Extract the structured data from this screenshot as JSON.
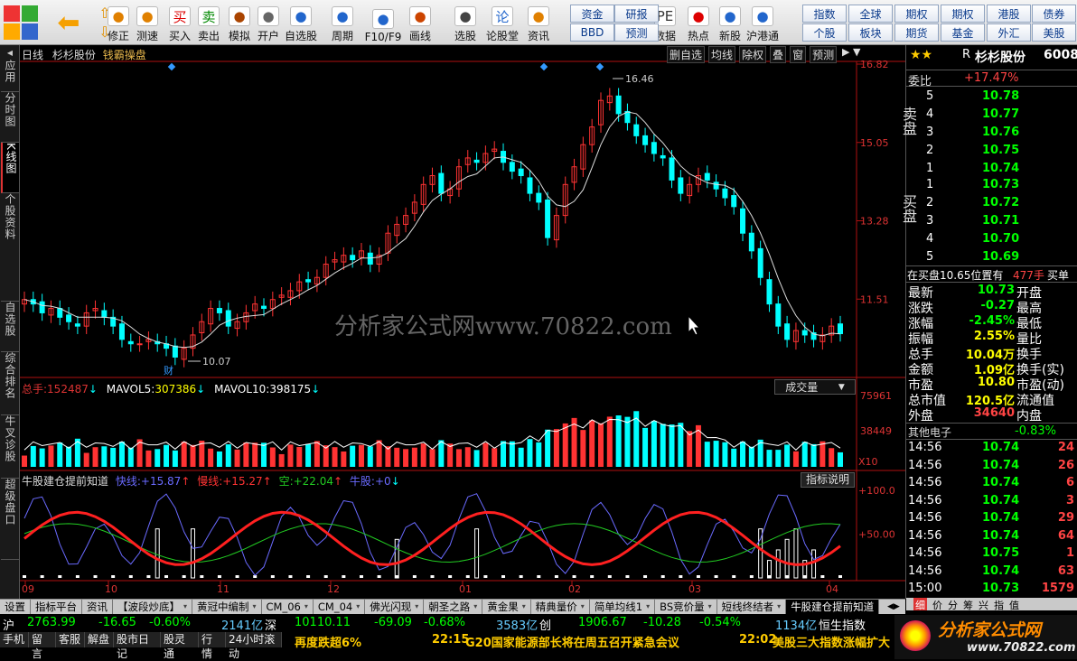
{
  "toolbar": {
    "buttons": [
      {
        "label": "修正",
        "icon": "arrow-up-down-icon"
      },
      {
        "label": "测速",
        "icon": "clock-icon"
      },
      {
        "label": "买入",
        "icon": "buy-icon",
        "glyph": "买"
      },
      {
        "label": "卖出",
        "icon": "sell-icon",
        "glyph": "卖"
      },
      {
        "label": "模拟",
        "icon": "hammer-icon"
      },
      {
        "label": "开户",
        "icon": "lock-icon"
      },
      {
        "label": "自选股",
        "icon": "star-icon"
      },
      {
        "label": "周期",
        "icon": "cycle-icon"
      },
      {
        "label": "F10/F9",
        "icon": "f10-icon"
      },
      {
        "label": "画线",
        "icon": "pencil-icon"
      },
      {
        "label": "选股",
        "icon": "filter-icon"
      },
      {
        "label": "论股堂",
        "icon": "forum-icon",
        "glyph": "论"
      },
      {
        "label": "资讯",
        "icon": "news-icon"
      },
      {
        "label": "数据",
        "icon": "pe-icon",
        "glyph": "PE"
      },
      {
        "label": "热点",
        "icon": "hot-icon"
      },
      {
        "label": "新股",
        "icon": "new-stock-icon"
      },
      {
        "label": "沪港通",
        "icon": "hk-connect-icon"
      }
    ],
    "blue_row1": [
      "资金",
      "研报"
    ],
    "blue_row2": [
      "BBD",
      "预测"
    ],
    "right_row1": [
      "指数",
      "全球",
      "期权",
      "期权",
      "港股",
      "债券"
    ],
    "right_row2": [
      "个股",
      "板块",
      "期货",
      "基金",
      "外汇",
      "美股"
    ]
  },
  "sidetabs": [
    "应用",
    "分时图",
    "K线图",
    "个股资料",
    "自选股",
    "综合排名",
    "牛叉诊股",
    "超级盘口"
  ],
  "chart": {
    "period": "日线",
    "stock": "杉杉股份",
    "indicator_name": "钱霸操盘",
    "buttons": [
      "删自选",
      "均线",
      "除权",
      "叠",
      "窗",
      "预测"
    ],
    "price_axis": [
      "16.82",
      "15.05",
      "13.28",
      "11.51"
    ],
    "high_label": "16.46",
    "low_label": "10.07",
    "cai_label": "财",
    "watermark": "分析家公式网www.70822.com",
    "volume": {
      "total_label": "总手:",
      "total": "152487",
      "ma5_label": "MAVOL5:",
      "ma5": "307386",
      "ma10_label": "MAVOL10:",
      "ma10": "398175",
      "dropdown": "成交量",
      "axis": [
        "75961",
        "38449"
      ],
      "unit": "X10"
    },
    "indicator": {
      "name": "牛股建仓提前知道",
      "fast_label": "快线:",
      "fast": "+15.87",
      "slow_label": "慢线:",
      "slow": "+15.27",
      "kong_label": "空:",
      "kong": "+22.04",
      "niu_label": "牛股:",
      "niu": "+0",
      "help": "指标说明",
      "axis": [
        "+100.0",
        "+50.00"
      ]
    },
    "x_labels": [
      "09",
      "10",
      "11",
      "12",
      "01",
      "02",
      "03",
      "04"
    ]
  },
  "quote": {
    "title": "杉杉股份",
    "code": "6008",
    "wb_label": "委比",
    "wb": "+17.47%",
    "sell_label": "卖盘",
    "buy_label": "买盘",
    "sell": [
      {
        "n": "5",
        "p": "10.78"
      },
      {
        "n": "4",
        "p": "10.77"
      },
      {
        "n": "3",
        "p": "10.76"
      },
      {
        "n": "2",
        "p": "10.75"
      },
      {
        "n": "1",
        "p": "10.74"
      }
    ],
    "buy": [
      {
        "n": "1",
        "p": "10.73"
      },
      {
        "n": "2",
        "p": "10.72"
      },
      {
        "n": "3",
        "p": "10.71"
      },
      {
        "n": "4",
        "p": "10.70"
      },
      {
        "n": "5",
        "p": "10.69"
      }
    ],
    "pos_text": "在买盘10.65位置有",
    "pos_vol": "477手",
    "pos_action": "买单",
    "stats": [
      {
        "l": "最新",
        "v": "10.73",
        "r": "开盘"
      },
      {
        "l": "涨跌",
        "v": "-0.27",
        "r": "最高"
      },
      {
        "l": "涨幅",
        "v": "-2.45%",
        "r": "最低"
      },
      {
        "l": "振幅",
        "v": "2.55%",
        "r": "量比"
      },
      {
        "l": "总手",
        "v": "10.04万",
        "r": "换手"
      },
      {
        "l": "金额",
        "v": "1.09亿",
        "r": "换手(实)"
      },
      {
        "l": "市盈",
        "v": "10.80",
        "r": "市盈(动)"
      },
      {
        "l": "总市值",
        "v": "120.5亿",
        "r": "流通值"
      },
      {
        "l": "外盘",
        "v": "34640",
        "r": "内盘"
      }
    ],
    "sector": "其他电子",
    "sector_chg": "-0.83%",
    "ticks": [
      {
        "t": "14:56",
        "p": "10.74",
        "v": "24"
      },
      {
        "t": "14:56",
        "p": "10.74",
        "v": "26"
      },
      {
        "t": "14:56",
        "p": "10.74",
        "v": "6"
      },
      {
        "t": "14:56",
        "p": "10.74",
        "v": "3"
      },
      {
        "t": "14:56",
        "p": "10.74",
        "v": "29"
      },
      {
        "t": "14:56",
        "p": "10.74",
        "v": "64"
      },
      {
        "t": "14:56",
        "p": "10.75",
        "v": "1"
      },
      {
        "t": "14:56",
        "p": "10.74",
        "v": "63"
      },
      {
        "t": "15:00",
        "p": "10.73",
        "v": "1579"
      }
    ]
  },
  "bottom_tabs": [
    "设置",
    "指标平台",
    "资讯",
    "【波段炒底】",
    "黄冠中编制",
    "CM_06",
    "CM_04",
    "佛光闪现",
    "朝圣之路",
    "黄金果",
    "精典量价",
    "简单均线1",
    "BS竞价量",
    "短线终结者",
    "牛股建仓提前知道"
  ],
  "ticker": {
    "sh_label": "沪",
    "sh": "2763.99",
    "sh_chg": "-16.65",
    "sh_pct": "-0.60%",
    "sh_amt": "2141亿",
    "sz_label": "深",
    "sz": "10110.11",
    "sz_chg": "-69.09",
    "sz_pct": "-0.68%",
    "sz_amt": "3583亿",
    "cy_label": "创",
    "cy": "1906.67",
    "cy_chg": "-10.28",
    "cy_pct": "-0.54%",
    "cy_amt": "1134亿",
    "hs_label": "恒生指数"
  },
  "status": {
    "items": [
      "手机",
      "留言",
      "客服",
      "解盘",
      "股市日记",
      "股灵通",
      "行情",
      "24小时滚动"
    ],
    "news1": "再度跌超6%",
    "news2_time": "22:15",
    "news2": "G20国家能源部长将在周五召开紧急会议",
    "news3_time": "22:02",
    "news3": "美股三大指数涨幅扩大"
  },
  "logo": {
    "text": "分析家公式网",
    "url": "www.70822.com"
  },
  "colors": {
    "up": "#ff3333",
    "down": "#00ffff",
    "fast": "#6a6aff",
    "slow": "#ff2020",
    "kong": "#22cc22",
    "border": "#b01010"
  }
}
